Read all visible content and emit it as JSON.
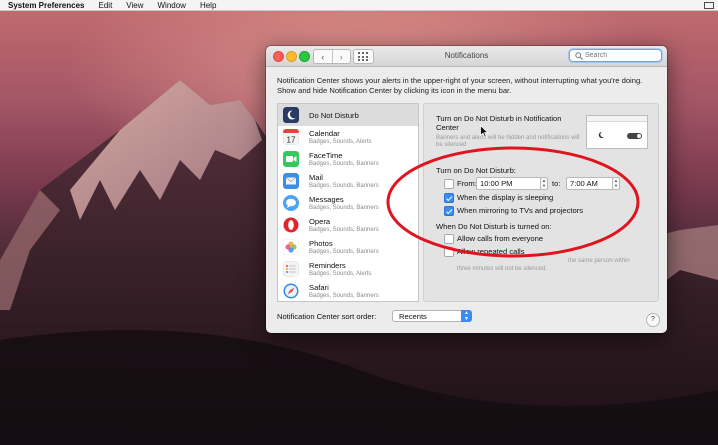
{
  "menubar": {
    "app_name": "System Preferences",
    "items": [
      "Edit",
      "View",
      "Window",
      "Help"
    ]
  },
  "window": {
    "title": "Notifications",
    "search_placeholder": "Search",
    "description": "Notification Center shows your alerts in the upper-right of your screen, without interrupting what you're doing. Show and hide Notification Center by clicking its icon in the menu bar."
  },
  "apps": [
    {
      "name": "Do Not Disturb",
      "sub": "",
      "icon": "moon-icon",
      "color": "#2b3a63"
    },
    {
      "name": "Calendar",
      "sub": "Badges, Sounds, Alerts",
      "icon": "calendar-icon",
      "color": "#f3f3f3"
    },
    {
      "name": "FaceTime",
      "sub": "Badges, Sounds, Banners",
      "icon": "facetime-icon",
      "color": "#35c85a"
    },
    {
      "name": "Mail",
      "sub": "Badges, Sounds, Banners",
      "icon": "mail-icon",
      "color": "#3a8ee6"
    },
    {
      "name": "Messages",
      "sub": "Badges, Sounds, Banners",
      "icon": "messages-icon",
      "color": "#4aa3f5"
    },
    {
      "name": "Opera",
      "sub": "Badges, Sounds, Banners",
      "icon": "opera-icon",
      "color": "#e0262b"
    },
    {
      "name": "Photos",
      "sub": "Badges, Sounds, Banners",
      "icon": "photos-icon",
      "color": "#f6a623"
    },
    {
      "name": "Reminders",
      "sub": "Badges, Sounds, Alerts",
      "icon": "reminders-icon",
      "color": "#f4f4f4"
    },
    {
      "name": "Safari",
      "sub": "Badges, Sounds, Banners",
      "icon": "safari-icon",
      "color": "#2d8be6"
    }
  ],
  "dnd": {
    "heading": "Turn on Do Not Disturb in Notification Center",
    "note": "Banners and alerts will be hidden and notifications will be silenced",
    "turn_on_label": "Turn on Do Not Disturb:",
    "from_label": "From:",
    "from_time": "10:00 PM",
    "to_label": "to:",
    "to_time": "7:00 AM",
    "from_checked": false,
    "display_sleeping_label": "When the display is sleeping",
    "display_sleeping_checked": true,
    "mirroring_label": "When mirroring to TVs and projectors",
    "mirroring_checked": true,
    "when_on_label": "When Do Not Disturb is turned on:",
    "allow_calls_label": "Allow calls from everyone",
    "allow_calls_checked": false,
    "allow_repeated_label": "Allow repeated calls",
    "allow_repeated_checked": false,
    "repeated_note_1": "the same person within",
    "repeated_note_2": "three minutes will not be silenced."
  },
  "sort": {
    "label": "Notification Center sort order:",
    "value": "Recents"
  },
  "help_label": "?",
  "colors": {
    "accent": "#3b8cf0",
    "annotation": "#e0141e"
  }
}
